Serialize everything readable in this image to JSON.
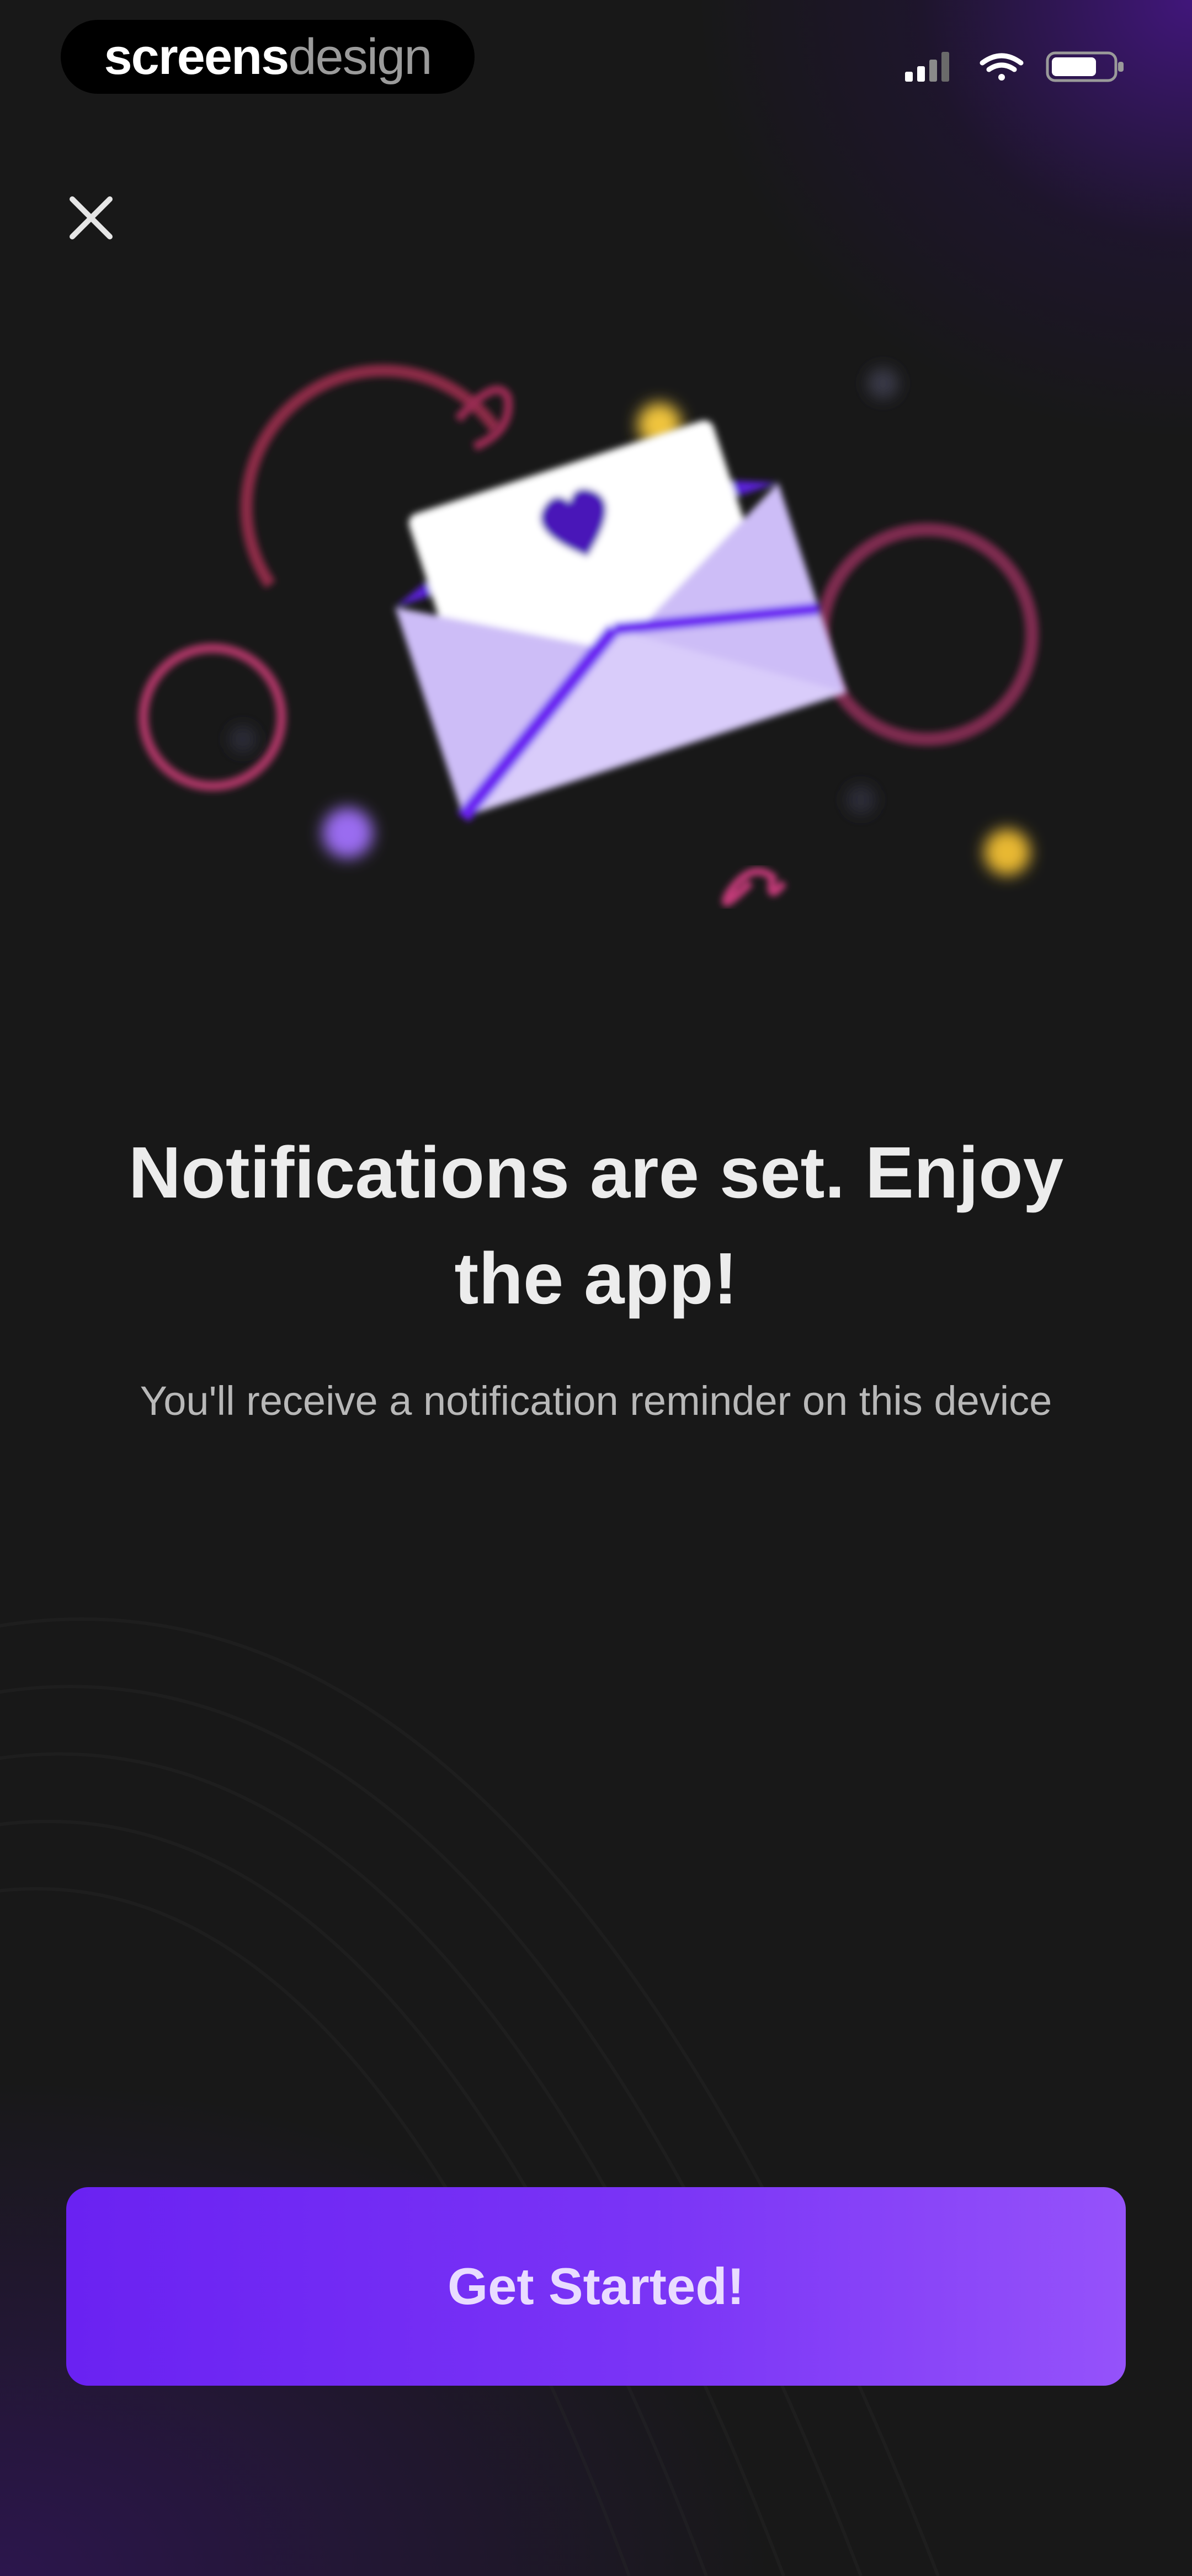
{
  "watermark": {
    "brand_strong": "screens",
    "brand_light": "design"
  },
  "status_bar": {
    "icons": [
      "cellular-signal-icon",
      "wifi-icon",
      "battery-icon"
    ]
  },
  "close_button": {
    "icon": "close-icon"
  },
  "illustration": {
    "subject": "envelope-with-heart-letter",
    "colors": {
      "envelope": "#cdbdf7",
      "envelope_stripe": "#6a22f2",
      "letter": "#ffffff",
      "heart": "#4a16b8",
      "ring_pink": "#a83464",
      "ring_red": "#8c2a46",
      "dot_yellow": "#f0c43c",
      "dot_purple": "#9a6cf0"
    }
  },
  "content": {
    "headline": "Notifications are set. Enjoy the app!",
    "subtitle": "You'll receive a notification reminder on this device"
  },
  "cta": {
    "label": "Get Started!"
  },
  "colors": {
    "background": "#181818",
    "accent": "#6a22f2",
    "accent_light": "#9552fa",
    "glow": "#48168c"
  }
}
